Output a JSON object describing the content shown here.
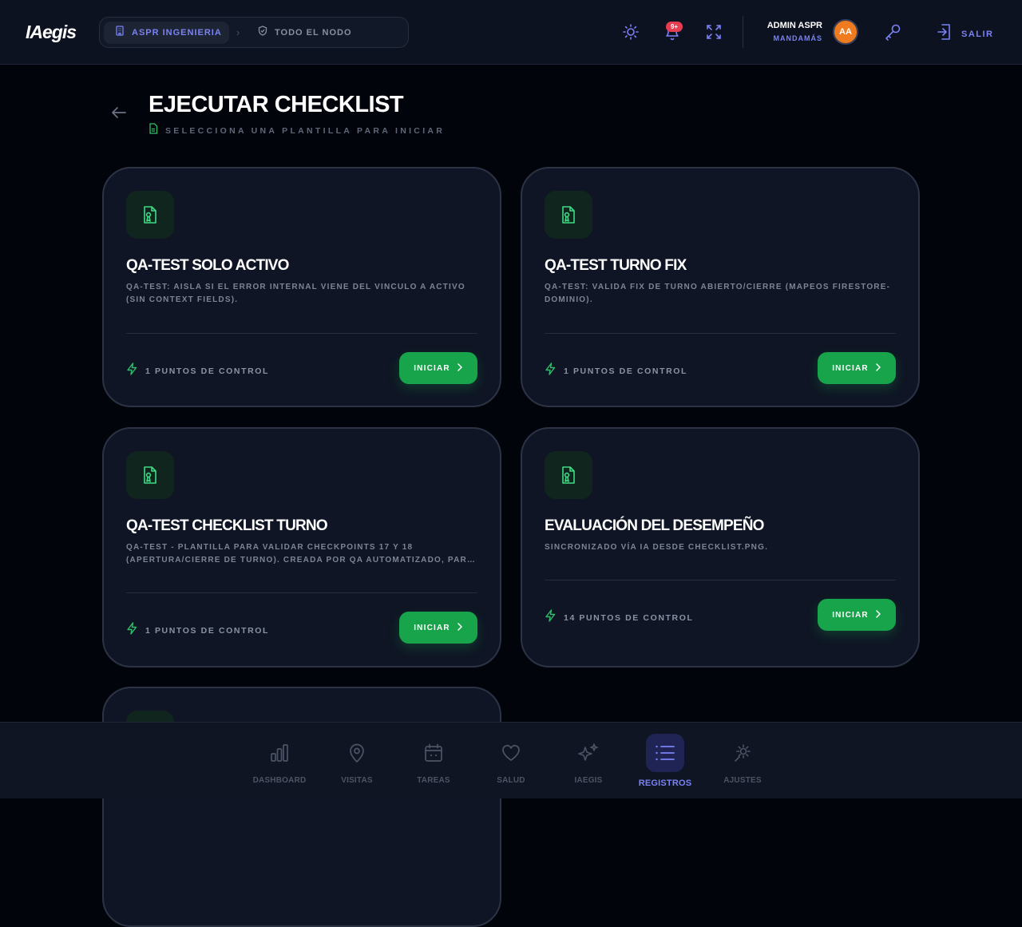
{
  "header": {
    "logo": "IAegis",
    "org": "ASPR INGENIERIA",
    "scope": "TODO EL NODO",
    "notifications_badge": "9+",
    "user_name": "ADMIN ASPR",
    "user_role": "MANDAMÁS",
    "user_initials": "AA",
    "logout_label": "SALIR"
  },
  "page": {
    "title": "EJECUTAR CHECKLIST",
    "subtitle": "SELECCIONA UNA PLANTILLA PARA INICIAR"
  },
  "cards": [
    {
      "title": "QA-TEST SOLO ACTIVO",
      "description": "QA-TEST: AISLA SI EL ERROR INTERNAL VIENE DEL VINCULO A ACTIVO (SIN CONTEXT FIELDS).",
      "points": "1 PUNTOS DE CONTROL",
      "button": "INICIAR"
    },
    {
      "title": "QA-TEST TURNO FIX",
      "description": "QA-TEST: VALIDA FIX DE TURNO ABIERTO/CIERRE (MAPEOS FIRESTORE-DOMINIO).",
      "points": "1 PUNTOS DE CONTROL",
      "button": "INICIAR"
    },
    {
      "title": "QA-TEST CHECKLIST TURNO",
      "description": "QA-TEST - PLANTILLA PARA VALIDAR CHECKPOINTS 17 Y 18 (APERTURA/CIERRE DE TURNO). CREADA POR QA AUTOMATIZADO, PARA VERIFICAR CHECKPOINTS",
      "points": "1 PUNTOS DE CONTROL",
      "button": "INICIAR"
    },
    {
      "title": "EVALUACIÓN DEL DESEMPEÑO",
      "description": "SINCRONIZADO VÍA IA DESDE CHECKLIST.PNG.",
      "points": "14 PUNTOS DE CONTROL",
      "button": "INICIAR"
    }
  ],
  "nav": [
    {
      "label": "DASHBOARD",
      "icon": "bar-chart-icon"
    },
    {
      "label": "VISITAS",
      "icon": "map-pin-icon"
    },
    {
      "label": "TAREAS",
      "icon": "calendar-icon"
    },
    {
      "label": "SALUD",
      "icon": "heart-icon"
    },
    {
      "label": "IAEGIS",
      "icon": "sparkles-icon"
    },
    {
      "label": "REGISTROS",
      "icon": "list-icon",
      "active": true
    },
    {
      "label": "AJUSTES",
      "icon": "settings-icon"
    }
  ],
  "colors": {
    "accent": "#7a82f5",
    "success": "#18a44a",
    "background": "#02040b",
    "surface": "#0f1524",
    "avatar": "#f07a1e",
    "badge": "#e53e52"
  }
}
